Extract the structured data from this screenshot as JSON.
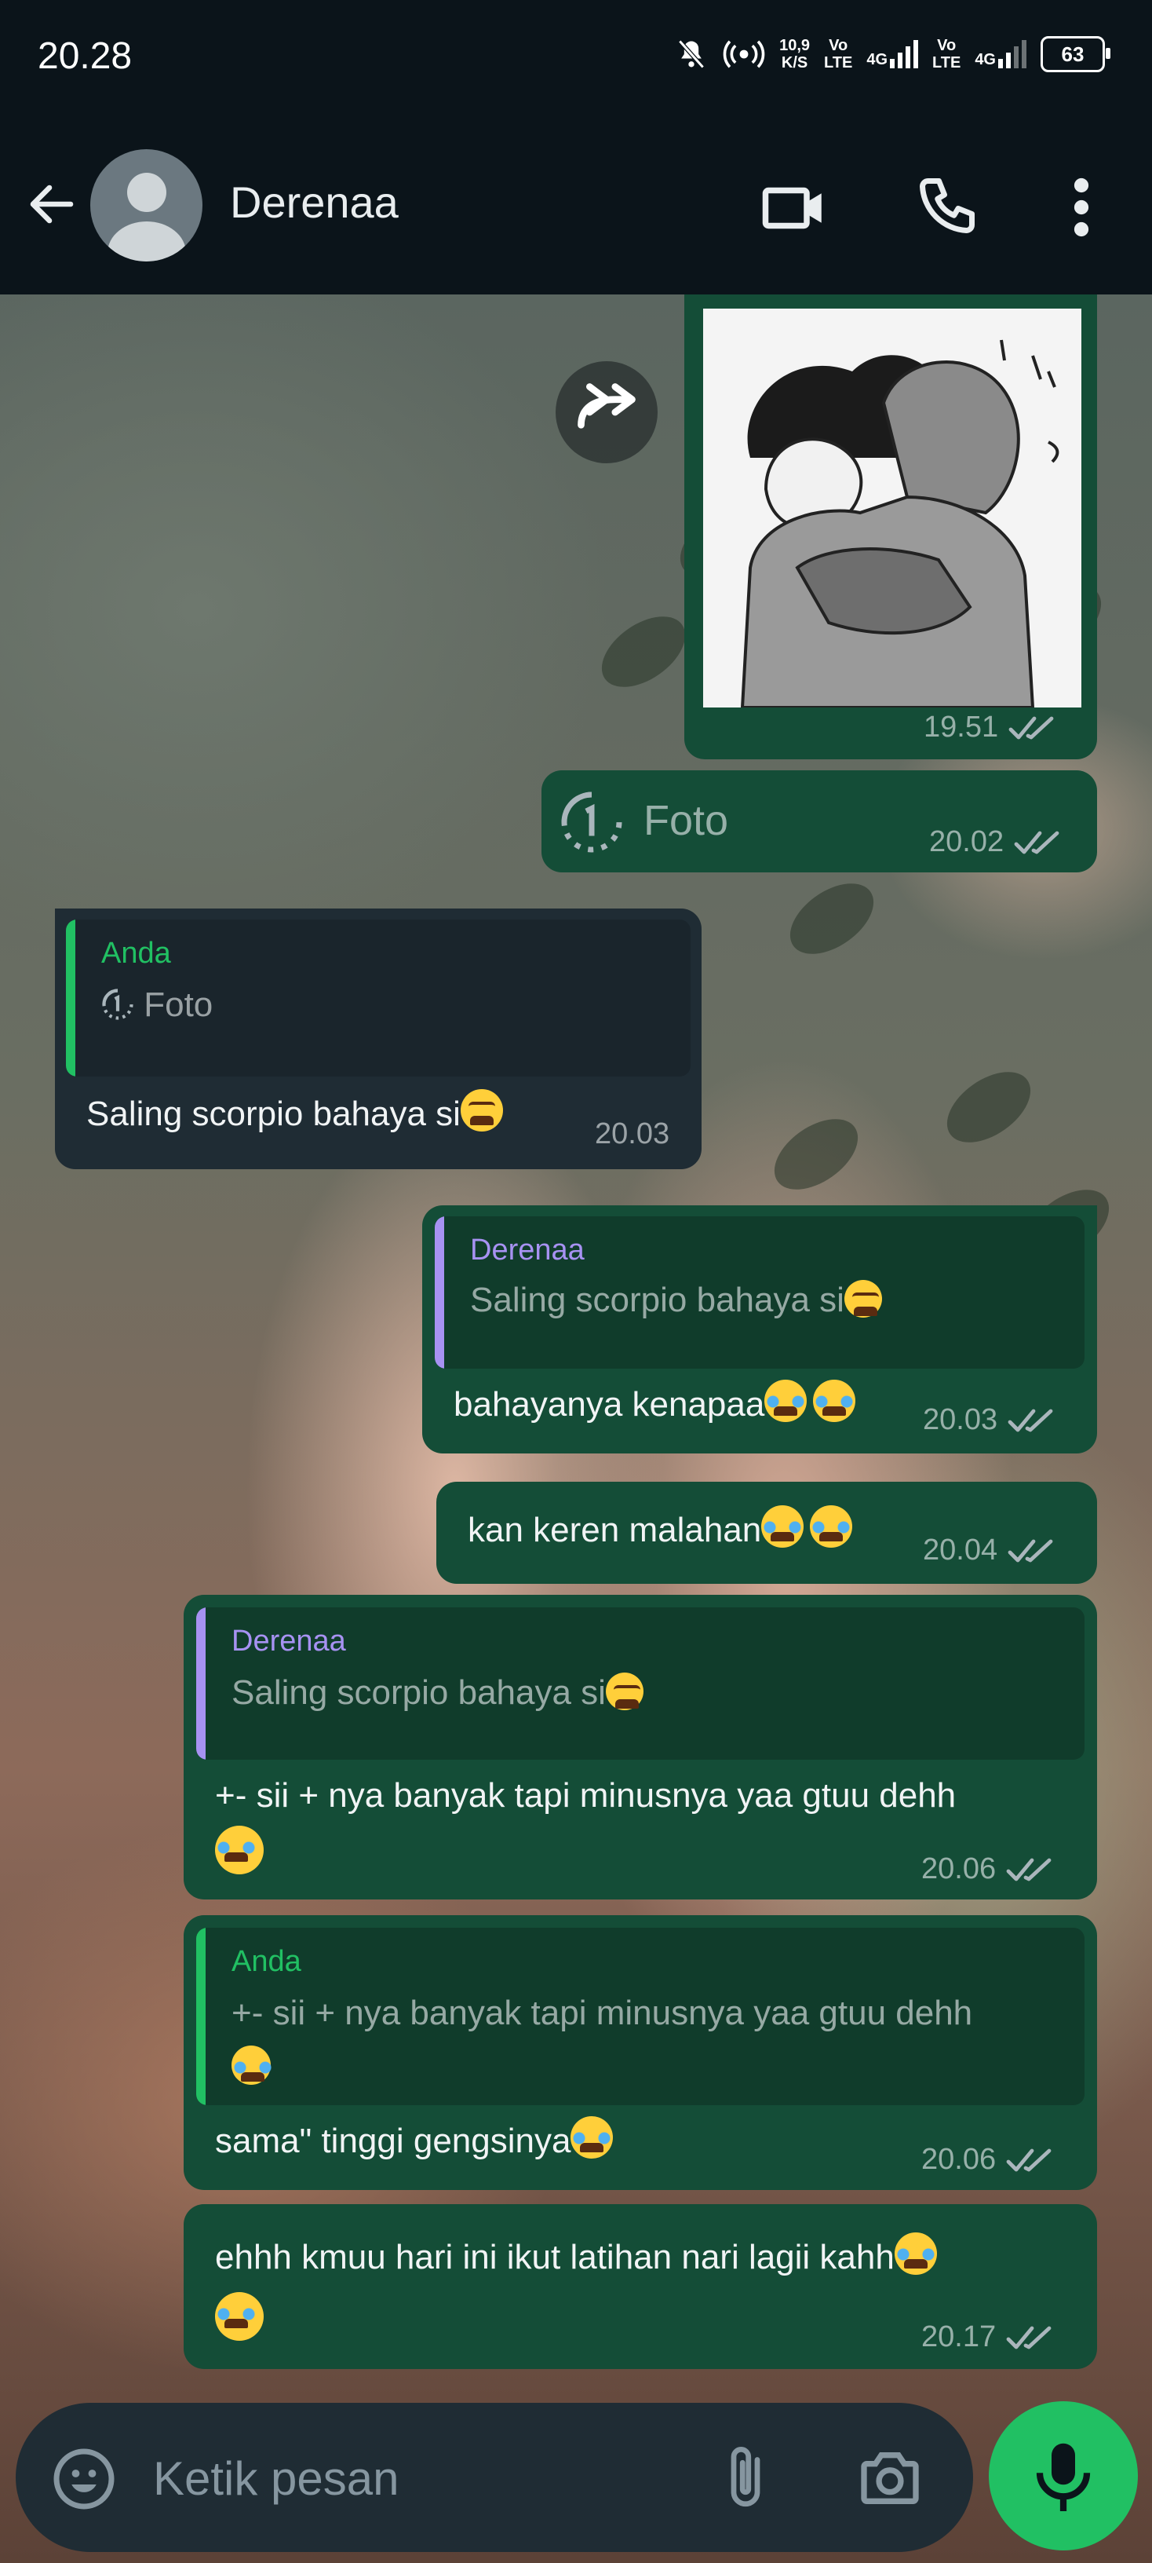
{
  "status_bar": {
    "time": "20.28",
    "net_speed_value": "10,9",
    "net_speed_unit": "K/S",
    "volte1": "Vo",
    "volte1_sub": "LTE",
    "lte1": "4G",
    "volte2": "Vo",
    "volte2_sub": "LTE",
    "lte2": "4G",
    "battery": "63"
  },
  "header": {
    "contact_name": "Derenaa"
  },
  "messages": [
    {
      "id": "m1",
      "type": "image",
      "direction": "outgoing",
      "time": "19.51",
      "status": "read"
    },
    {
      "id": "m2",
      "type": "view_once_photo",
      "direction": "outgoing",
      "label": "Foto",
      "time": "20.02",
      "status": "read"
    },
    {
      "id": "m3",
      "direction": "incoming",
      "quote_author": "Anda",
      "quote_text": "Foto",
      "text": "Saling scorpio bahaya si",
      "time": "20.03"
    },
    {
      "id": "m4",
      "direction": "outgoing",
      "quote_author": "Derenaa",
      "quote_text": "Saling scorpio bahaya si",
      "text": "bahayanya kenapaa",
      "time": "20.03",
      "status": "read"
    },
    {
      "id": "m5",
      "direction": "outgoing",
      "text": "kan keren malahan",
      "time": "20.04",
      "status": "read"
    },
    {
      "id": "m6",
      "direction": "outgoing",
      "quote_author": "Derenaa",
      "quote_text": "Saling scorpio bahaya si",
      "text": "+- sii + nya banyak tapi minusnya yaa gtuu dehh",
      "time": "20.06",
      "status": "read"
    },
    {
      "id": "m7",
      "direction": "outgoing",
      "quote_author": "Anda",
      "quote_text": "+- sii + nya banyak tapi minusnya yaa gtuu dehh",
      "text": "sama\" tinggi gengsinya",
      "time": "20.06",
      "status": "read"
    },
    {
      "id": "m8",
      "direction": "outgoing",
      "text": "ehhh kmuu hari ini ikut latihan nari lagii kahh",
      "time": "20.17",
      "status": "read"
    }
  ],
  "composer": {
    "placeholder": "Ketik pesan"
  },
  "icons": {
    "back": "arrow-left-icon",
    "video": "video-call-icon",
    "phone": "phone-call-icon",
    "menu": "more-vertical-icon",
    "emoji": "emoji-icon",
    "attach": "paperclip-icon",
    "camera": "camera-icon",
    "mic": "microphone-icon",
    "forward": "forward-icon",
    "view_once": "view-once-icon"
  },
  "colors": {
    "app_bar": "#0b141a",
    "outgoing_bubble": "#144d37",
    "incoming_bubble": "#1f2c34",
    "accent_green": "#21c063",
    "quote_purple": "#a792f2",
    "read_ticks": "#aab6bc"
  }
}
